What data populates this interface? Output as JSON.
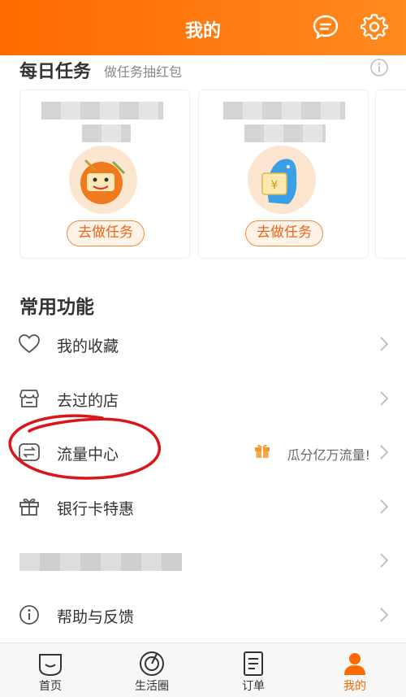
{
  "header": {
    "title": "我的"
  },
  "daily": {
    "title": "每日任务",
    "subtitle": "做任务抽红包",
    "cards": [
      {
        "button": "去做任务"
      },
      {
        "button": "去做任务"
      }
    ]
  },
  "common": {
    "title": "常用功能",
    "items": [
      {
        "label": "我的收藏",
        "icon": "heart-icon"
      },
      {
        "label": "去过的店",
        "icon": "store-icon"
      },
      {
        "label": "流量中心",
        "icon": "data-exchange-icon",
        "promo": "瓜分亿万流量!"
      },
      {
        "label": "银行卡特惠",
        "icon": "gift-icon"
      },
      {
        "label": "",
        "icon": ""
      },
      {
        "label": "帮助与反馈",
        "icon": "info-icon"
      }
    ]
  },
  "tabbar": {
    "tabs": [
      {
        "label": "首页"
      },
      {
        "label": "生活圈"
      },
      {
        "label": "订单"
      },
      {
        "label": "我的"
      }
    ]
  },
  "colors": {
    "accent": "#ff6a00",
    "button_border": "#f08a3e"
  }
}
